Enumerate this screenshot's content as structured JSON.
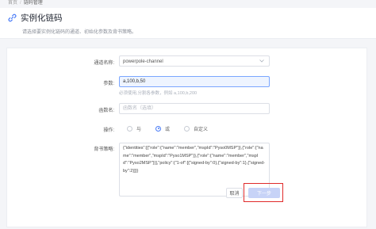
{
  "breadcrumb": {
    "home": "首页",
    "current": "链码管理"
  },
  "header": {
    "title": "实例化链码",
    "subtitle": "请选择要实例化链码的通道、初始化参数及背书策略。"
  },
  "form": {
    "channel": {
      "label": "通道名称:",
      "value": "powerpole-channel"
    },
    "args": {
      "label": "参数:",
      "value": "a,100,b,50",
      "hint": "必须使用,分割各参数，例如 a,100,b,200"
    },
    "func": {
      "label": "函数名:",
      "placeholder": "函数名（选填）"
    },
    "operation": {
      "label": "操作:",
      "options": [
        "与",
        "或",
        "自定义"
      ],
      "selected": "或"
    },
    "policy": {
      "label": "背书策略:",
      "value": "{\"identities\":[{\"role\":{\"name\":\"member\",\"mspId\":\"Pyso0MSP\"}},{\"role\":{\"name\":\"member\",\"mspId\":\"Pyso1MSP\"}},{\"role\":{\"name\":\"member\",\"mspId\":\"Pyso2MSP\"}}],\"policy\":{\"1-of\":[{\"signed-by\":0},{\"signed-by\":1},{\"signed-by\":2}]}}"
    }
  },
  "buttons": {
    "cancel": "取消",
    "next": "下一步"
  },
  "colors": {
    "accent": "#4a7cf7",
    "highlight": "#e02b2b"
  }
}
